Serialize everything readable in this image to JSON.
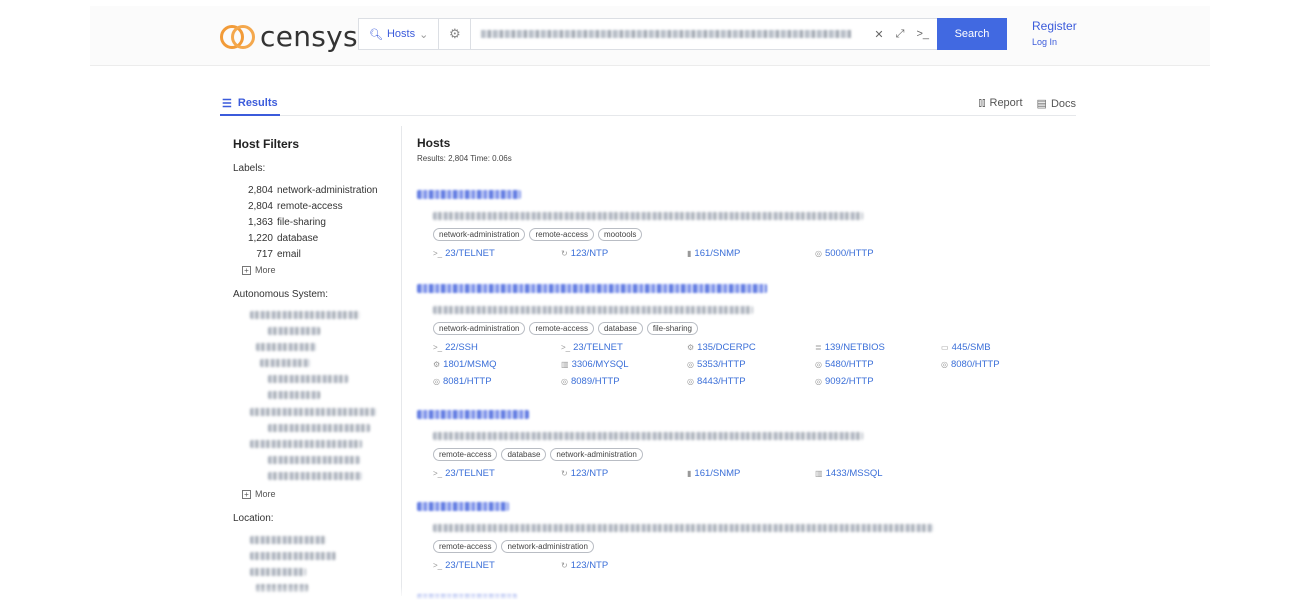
{
  "header": {
    "logo_text": "censys",
    "search_type": "Hosts",
    "search_button": "Search",
    "register": "Register",
    "login": "Log In",
    "console_glyph": ">_"
  },
  "tabs": {
    "results": "Results",
    "report": "Report",
    "docs": "Docs"
  },
  "sidebar": {
    "title": "Host Filters",
    "labels_heading": "Labels:",
    "labels": [
      {
        "count": "2,804",
        "name": "network-administration"
      },
      {
        "count": "2,804",
        "name": "remote-access"
      },
      {
        "count": "1,363",
        "name": "file-sharing"
      },
      {
        "count": "1,220",
        "name": "database"
      },
      {
        "count": "717",
        "name": "email"
      }
    ],
    "more": "More",
    "as_heading": "Autonomous System:",
    "location_heading": "Location:"
  },
  "results": {
    "title": "Hosts",
    "meta": "Results: 2,804   Time: 0.06s",
    "hosts": [
      {
        "tags": [
          "network-administration",
          "remote-access",
          "mootools"
        ],
        "services": [
          "23/TELNET",
          "123/NTP",
          "161/SNMP",
          "5000/HTTP"
        ]
      },
      {
        "tags": [
          "network-administration",
          "remote-access",
          "database",
          "file-sharing"
        ],
        "services": [
          "22/SSH",
          "23/TELNET",
          "135/DCERPC",
          "139/NETBIOS",
          "445/SMB",
          "1801/MSMQ",
          "3306/MYSQL",
          "5353/HTTP",
          "5480/HTTP",
          "8080/HTTP",
          "8081/HTTP",
          "8089/HTTP",
          "8443/HTTP",
          "9092/HTTP"
        ]
      },
      {
        "tags": [
          "remote-access",
          "database",
          "network-administration"
        ],
        "services": [
          "23/TELNET",
          "123/NTP",
          "161/SNMP",
          "1433/MSSQL"
        ]
      },
      {
        "tags": [
          "remote-access",
          "network-administration"
        ],
        "services": [
          "23/TELNET",
          "123/NTP"
        ]
      }
    ]
  },
  "colors": {
    "accent": "#4169e1",
    "link": "#3b6fd8",
    "logo": "#f29b38"
  }
}
